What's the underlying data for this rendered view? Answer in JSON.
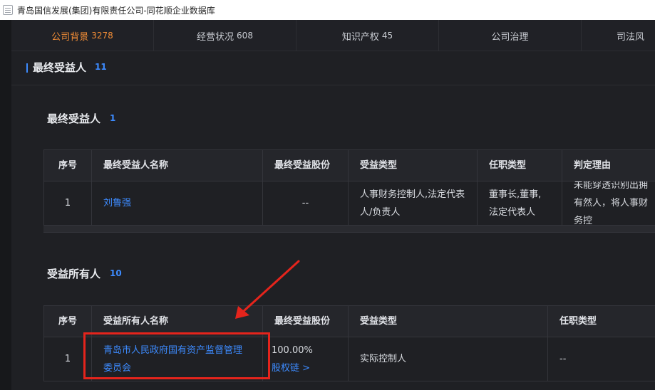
{
  "window": {
    "title": "青岛国信发展(集团)有限责任公司-同花顺企业数据库"
  },
  "tabs": [
    {
      "label": "公司背景",
      "count": "3278"
    },
    {
      "label": "经营状况",
      "count": "608"
    },
    {
      "label": "知识产权",
      "count": "45"
    },
    {
      "label": "公司治理",
      "count": ""
    },
    {
      "label": "司法风",
      "count": ""
    }
  ],
  "section": {
    "title": "最终受益人",
    "count": "11"
  },
  "ubo": {
    "title": "最终受益人",
    "count": "1",
    "headers": [
      "序号",
      "最终受益人名称",
      "最终受益股份",
      "受益类型",
      "任职类型",
      "判定理由"
    ],
    "rows": [
      {
        "index": "1",
        "name": "刘鲁强",
        "share": "--",
        "type": "人事财务控制人,法定代表人/负责人",
        "position": "董事长,董事,法定代表人",
        "reason": "未能穿透识别出拥有然人，将人事财务控"
      }
    ]
  },
  "beneficial_owners": {
    "title": "受益所有人",
    "count": "10",
    "headers": [
      "序号",
      "受益所有人名称",
      "最终受益股份",
      "受益类型",
      "任职类型"
    ],
    "rows": [
      {
        "index": "1",
        "name": "青岛市人民政府国有资产监督管理委员会",
        "share": "100.00%",
        "equity_link": "股权链 >",
        "type": "实际控制人",
        "position": "--"
      }
    ]
  },
  "annotation": {
    "color": "#e5241c"
  }
}
